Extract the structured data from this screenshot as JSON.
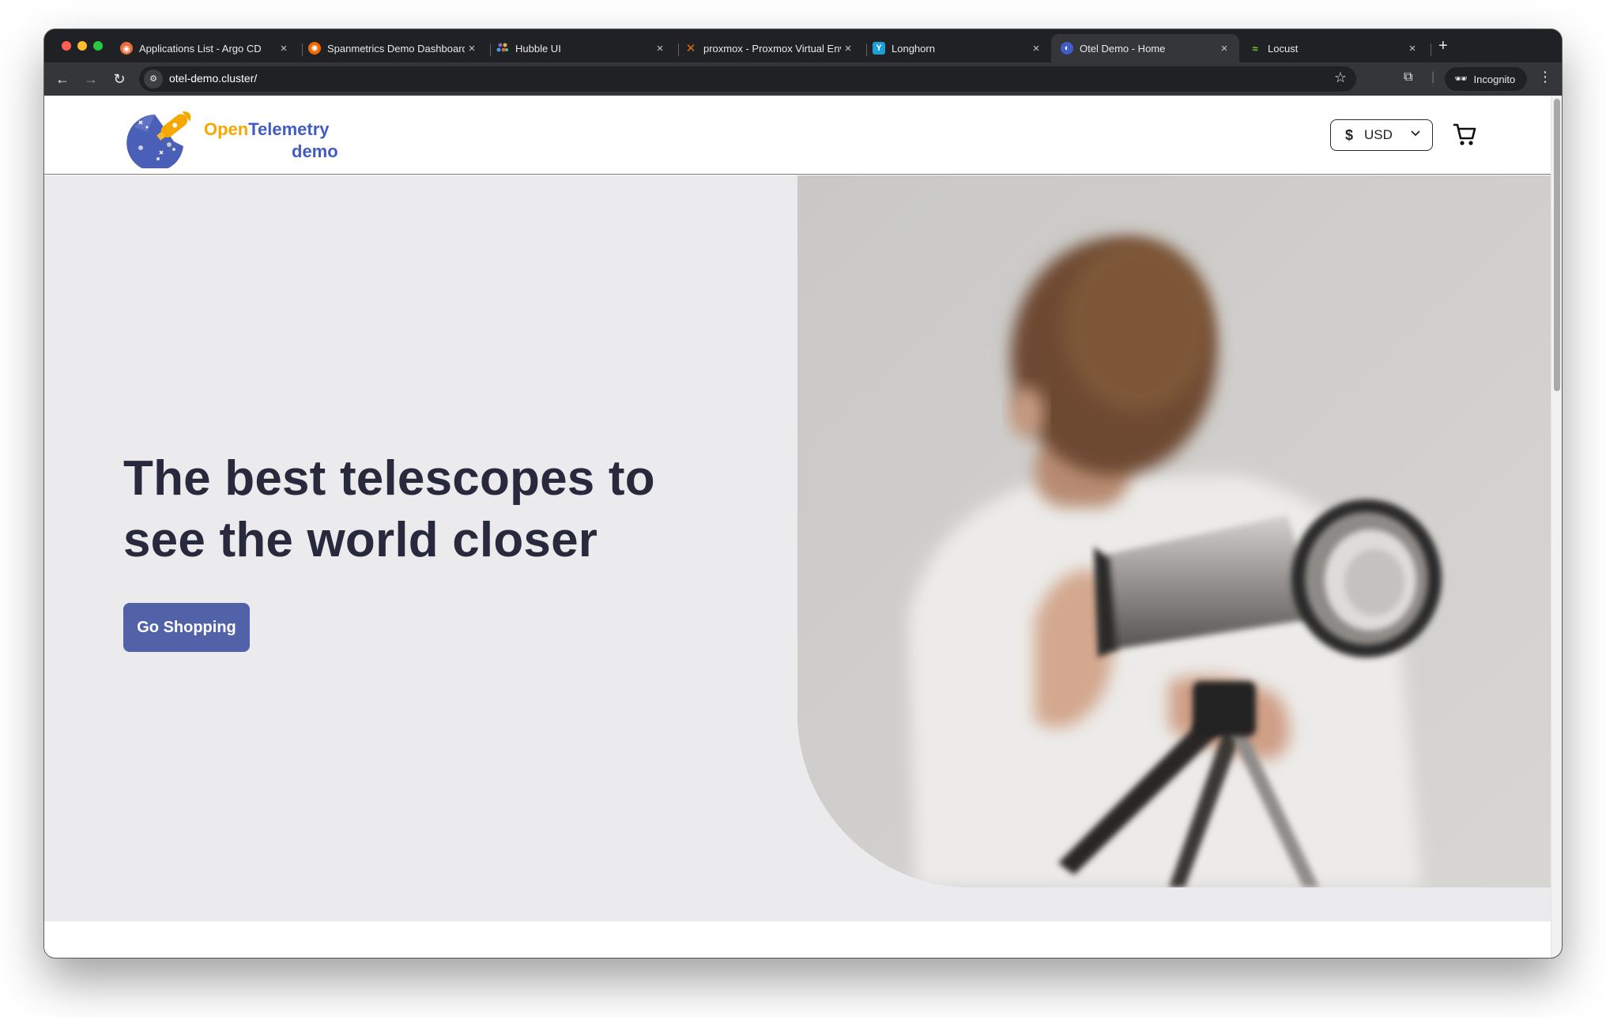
{
  "browser": {
    "tabs": [
      {
        "title": "Applications List - Argo CD",
        "favicon": "argo-icon",
        "color": "#e96d3b"
      },
      {
        "title": "Spanmetrics Demo Dashboard",
        "favicon": "grafana-icon",
        "color": "#f46800"
      },
      {
        "title": "Hubble UI",
        "favicon": "hubble-icon",
        "color": "#8a63d2"
      },
      {
        "title": "proxmox - Proxmox Virtual Environment",
        "favicon": "proxmox-icon",
        "color": "#e57000"
      },
      {
        "title": "Longhorn",
        "favicon": "longhorn-icon",
        "color": "#1f9fd8"
      },
      {
        "title": "Otel Demo - Home",
        "favicon": "otel-icon",
        "color": "#425cc7",
        "active": true
      },
      {
        "title": "Locust",
        "favicon": "locust-icon",
        "color": "#7ccc22"
      }
    ],
    "new_tab": "+",
    "url": "otel-demo.cluster/",
    "profile_label": "Incognito"
  },
  "site": {
    "logo_text_open": "Open",
    "logo_text_telemetry": "Telemetry",
    "logo_text_demo": "demo",
    "currency_symbol": "$",
    "currency_value": "USD",
    "hero_title": "The best telescopes to see the world closer",
    "cta_label": "Go Shopping",
    "colors": {
      "hero_bg": "#ebebed",
      "title": "#29293e",
      "cta": "#5262a8",
      "logo_orange": "#f5a800",
      "logo_blue": "#425cc7"
    }
  }
}
